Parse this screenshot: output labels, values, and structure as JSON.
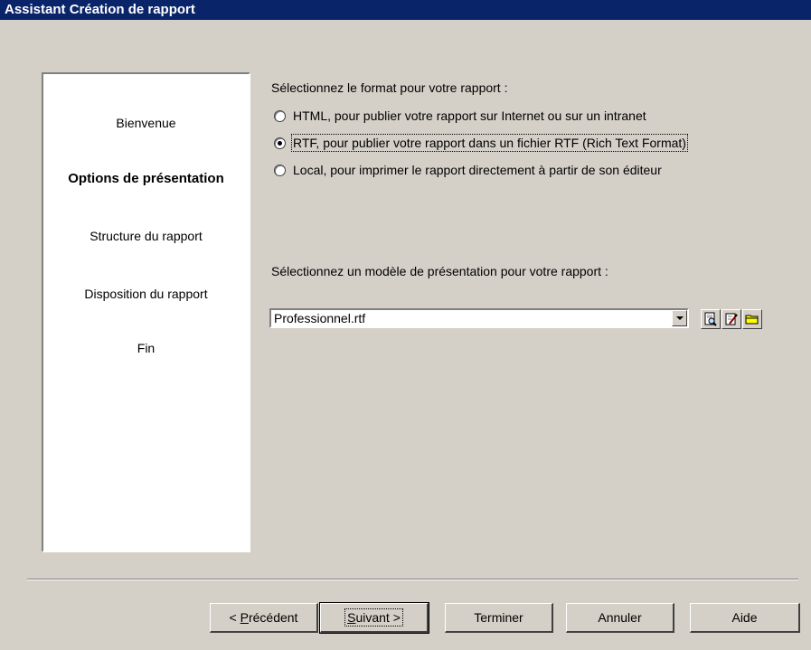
{
  "window": {
    "title": "Assistant Création de rapport"
  },
  "steps": [
    {
      "label": "Bienvenue",
      "active": false
    },
    {
      "label": "Options de présentation",
      "active": true
    },
    {
      "label": "Structure du rapport",
      "active": false
    },
    {
      "label": "Disposition du rapport",
      "active": false
    },
    {
      "label": "Fin",
      "active": false
    }
  ],
  "format": {
    "prompt": "Sélectionnez le format pour votre rapport :",
    "options": [
      {
        "label": "HTML, pour publier votre rapport sur Internet ou sur un intranet",
        "selected": false
      },
      {
        "label": "RTF, pour publier votre rapport dans un fichier RTF (Rich Text Format)",
        "selected": true
      },
      {
        "label": "Local, pour imprimer le rapport directement à partir de son éditeur",
        "selected": false
      }
    ]
  },
  "template": {
    "prompt": "Sélectionnez un modèle de présentation pour votre rapport :",
    "value": "Professionnel.rtf",
    "tools": [
      "preview-icon",
      "edit-icon",
      "folder-icon"
    ]
  },
  "buttons": {
    "previous": {
      "prefix": "< ",
      "mnemonic": "P",
      "rest": "récédent"
    },
    "next": {
      "mnemonic": "S",
      "rest": "uivant >"
    },
    "finish": "Terminer",
    "cancel": "Annuler",
    "help": "Aide"
  },
  "colors": {
    "titlebar": "#0a246a",
    "face": "#d4d0c8",
    "icon_accent": "#ffff00"
  }
}
